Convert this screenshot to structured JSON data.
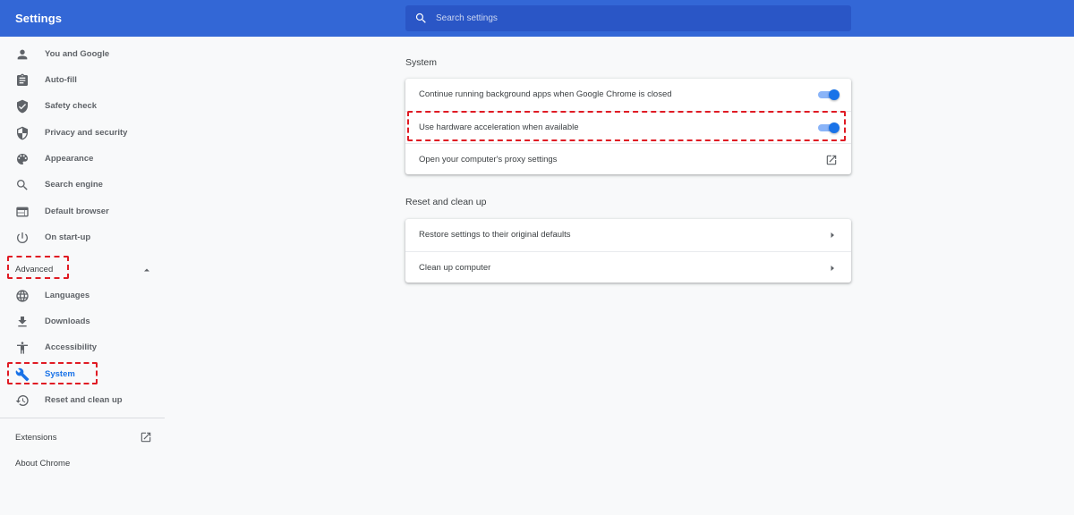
{
  "header": {
    "title": "Settings",
    "search_placeholder": "Search settings"
  },
  "sidebar": {
    "items": [
      {
        "label": "You and Google",
        "icon": "person-icon"
      },
      {
        "label": "Auto-fill",
        "icon": "clipboard-icon"
      },
      {
        "label": "Safety check",
        "icon": "shield-check-icon"
      },
      {
        "label": "Privacy and security",
        "icon": "shield-icon"
      },
      {
        "label": "Appearance",
        "icon": "palette-icon"
      },
      {
        "label": "Search engine",
        "icon": "search-icon"
      },
      {
        "label": "Default browser",
        "icon": "browser-icon"
      },
      {
        "label": "On start-up",
        "icon": "power-icon"
      }
    ],
    "advanced_label": "Advanced",
    "advanced_items": [
      {
        "label": "Languages",
        "icon": "globe-icon"
      },
      {
        "label": "Downloads",
        "icon": "download-icon"
      },
      {
        "label": "Accessibility",
        "icon": "accessibility-icon"
      },
      {
        "label": "System",
        "icon": "wrench-icon",
        "active": true
      },
      {
        "label": "Reset and clean up",
        "icon": "history-icon"
      }
    ],
    "extensions_label": "Extensions",
    "about_label": "About Chrome"
  },
  "main": {
    "system": {
      "title": "System",
      "rows": [
        {
          "label": "Continue running background apps when Google Chrome is closed",
          "type": "toggle",
          "on": true
        },
        {
          "label": "Use hardware acceleration when available",
          "type": "toggle",
          "on": true
        },
        {
          "label": "Open your computer's proxy settings",
          "type": "external-link"
        }
      ]
    },
    "reset": {
      "title": "Reset and clean up",
      "rows": [
        {
          "label": "Restore settings to their original defaults",
          "type": "subpage"
        },
        {
          "label": "Clean up computer",
          "type": "subpage"
        }
      ]
    }
  },
  "colors": {
    "header_bg": "#3367d6",
    "accent": "#1a73e8",
    "highlight": "#e01b24"
  }
}
